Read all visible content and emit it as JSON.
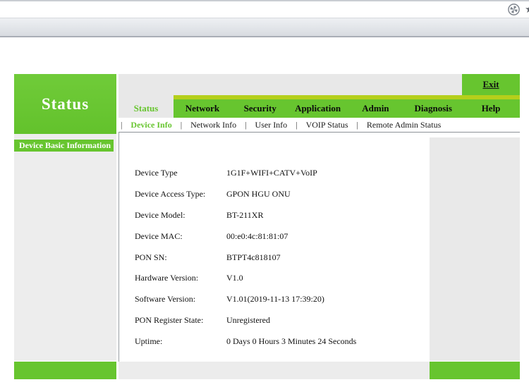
{
  "colors": {
    "accent_green": "#67c52f",
    "tab_stripe": "#b5cf1b"
  },
  "browser": {
    "icons": {
      "favorites_star": "★"
    }
  },
  "header": {
    "section_title": "Status",
    "exit_label": "Exit"
  },
  "nav": {
    "tabs": [
      {
        "label": "Status",
        "active": true
      },
      {
        "label": "Network",
        "active": false
      },
      {
        "label": "Security",
        "active": false
      },
      {
        "label": "Application",
        "active": false
      },
      {
        "label": "Admin",
        "active": false
      },
      {
        "label": "Diagnosis",
        "active": false
      },
      {
        "label": "Help",
        "active": false
      }
    ]
  },
  "subnav": {
    "items": [
      {
        "label": "Device Info",
        "active": true
      },
      {
        "label": "Network Info",
        "active": false
      },
      {
        "label": "User Info",
        "active": false
      },
      {
        "label": "VOIP Status",
        "active": false
      },
      {
        "label": "Remote Admin Status",
        "active": false
      }
    ]
  },
  "sidebar": {
    "items": [
      {
        "label": "Device Basic Information",
        "active": true
      }
    ]
  },
  "device_info": {
    "rows": [
      {
        "label": "Device Type",
        "value": "1G1F+WIFI+CATV+VoIP"
      },
      {
        "label": "Device Access Type:",
        "value": "GPON HGU ONU"
      },
      {
        "label": "Device Model:",
        "value": "BT-211XR"
      },
      {
        "label": "Device MAC:",
        "value": "00:e0:4c:81:81:07"
      },
      {
        "label": "PON SN:",
        "value": "BTPT4c818107"
      },
      {
        "label": "Hardware Version:",
        "value": "V1.0"
      },
      {
        "label": "Software Version:",
        "value": "V1.01(2019-11-13 17:39:20)"
      },
      {
        "label": "PON Register State:",
        "value": "Unregistered"
      },
      {
        "label": "Uptime:",
        "value": "0 Days 0 Hours 3 Minutes 24 Seconds"
      }
    ]
  }
}
